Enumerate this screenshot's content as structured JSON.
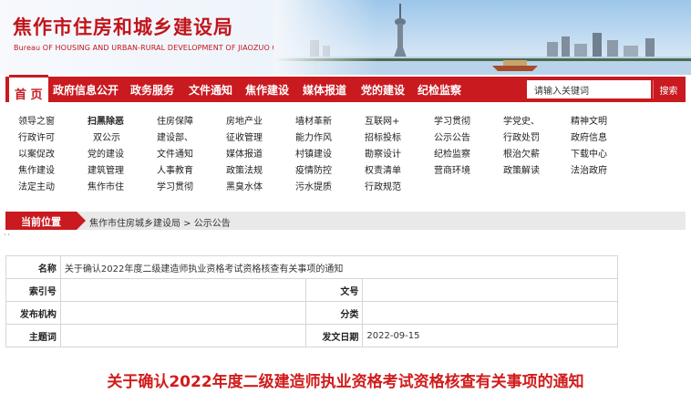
{
  "header": {
    "title": "焦作市住房和城乡建设局",
    "subtitle": "Bureau OF HOUSING AND URBAN-RURAL DEVELOPMENT OF JIAOZUO CITY"
  },
  "nav": {
    "items": [
      "首 页",
      "政府信息公开",
      "政务服务",
      "文件通知",
      "焦作建设",
      "媒体报道",
      "党的建设",
      "纪检监察"
    ],
    "search_placeholder": "请输入关键词",
    "search_button": "搜索"
  },
  "quick_links": [
    [
      "领导之窗",
      "扫黑除恶",
      "住房保障",
      "房地产业",
      "墙材革新",
      "互联网+",
      "学习贯彻",
      "学党史、",
      "精神文明"
    ],
    [
      "行政许可",
      "双公示",
      "建设部、",
      "征收管理",
      "能力作风",
      "招标投标",
      "公示公告",
      "行政处罚",
      "政府信息"
    ],
    [
      "以案促改",
      "党的建设",
      "文件通知",
      "媒体报道",
      "村镇建设",
      "勘察设计",
      "纪检监察",
      "根治欠薪",
      "下载中心"
    ],
    [
      "焦作建设",
      "建筑管理",
      "人事教育",
      "政策法规",
      "疫情防控",
      "权责清单",
      "营商环境",
      "政策解读",
      "法治政府"
    ],
    [
      "法定主动",
      "焦作市住",
      "学习贯彻",
      "黑臭水体",
      "污水提质",
      "行政规范"
    ]
  ],
  "breadcrumb": {
    "label": "当前位置",
    "path": "焦作市住房城乡建设局 > 公示公告"
  },
  "stray_mark": "``",
  "info": {
    "name_label": "名称",
    "name_value": "关于确认2022年度二级建造师执业资格考试资格核查有关事项的通知",
    "index_label": "索引号",
    "index_value": "",
    "docno_label": "文号",
    "docno_value": "",
    "org_label": "发布机构",
    "org_value": "",
    "category_label": "分类",
    "category_value": "",
    "subject_label": "主题词",
    "subject_value": "",
    "date_label": "发文日期",
    "date_value": "2022-09-15"
  },
  "document_title": "关于确认2022年度二级建造师执业资格考试资格核查有关事项的通知",
  "colors": {
    "brand_red": "#c91a20",
    "title_red": "#d11c1c"
  }
}
